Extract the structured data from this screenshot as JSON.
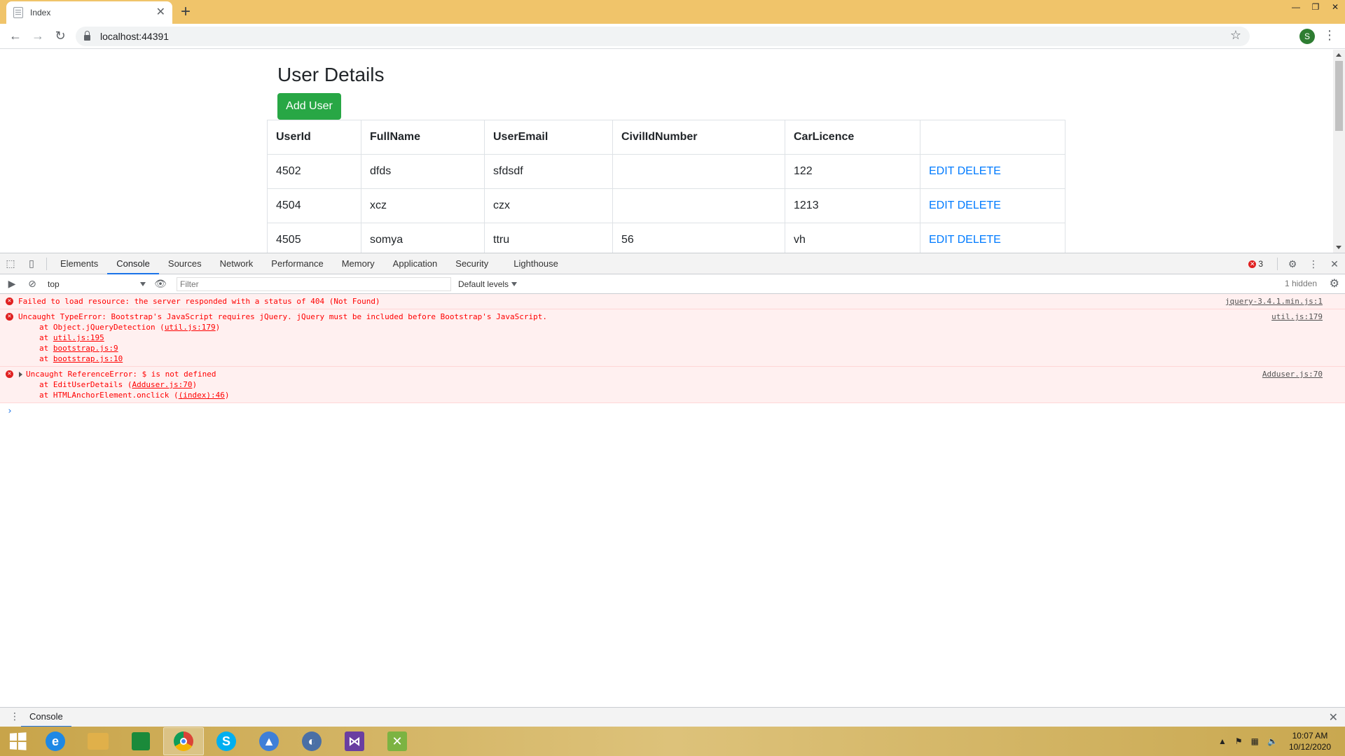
{
  "browser": {
    "tab_title": "Index",
    "url": "localhost:44391",
    "profile_initial": "S"
  },
  "page": {
    "title": "User Details",
    "add_user_label": "Add User",
    "table": {
      "headers": [
        "UserId",
        "FullName",
        "UserEmail",
        "CivilIdNumber",
        "CarLicence",
        ""
      ],
      "rows": [
        {
          "id": "4502",
          "name": "dfds",
          "email": "sfdsdf",
          "civil": "",
          "car": "122",
          "edit": "EDIT",
          "delete": "DELETE"
        },
        {
          "id": "4504",
          "name": "xcz",
          "email": "czx",
          "civil": "",
          "car": "1213",
          "edit": "EDIT",
          "delete": "DELETE"
        },
        {
          "id": "4505",
          "name": "somya",
          "email": "ttru",
          "civil": "56",
          "car": "vh",
          "edit": "EDIT",
          "delete": "DELETE"
        }
      ]
    }
  },
  "devtools": {
    "tabs": [
      "Elements",
      "Console",
      "Sources",
      "Network",
      "Performance",
      "Memory",
      "Application",
      "Security",
      "Lighthouse"
    ],
    "active_tab": "Console",
    "error_count": "3",
    "context": "top",
    "filter_placeholder": "Filter",
    "levels": "Default levels",
    "hidden": "1 hidden",
    "messages": [
      {
        "text": "Failed to load resource: the server responded with a status of 404 (Not Found)",
        "source": "jquery-3.4.1.min.js:1"
      },
      {
        "text": "Uncaught TypeError: Bootstrap's JavaScript requires jQuery. jQuery must be included before Bootstrap's JavaScript.",
        "source": "util.js:179",
        "stack": [
          {
            "prefix": "at Object.jQueryDetection (",
            "link": "util.js:179",
            "suffix": ")"
          },
          {
            "prefix": "at ",
            "link": "util.js:195",
            "suffix": ""
          },
          {
            "prefix": "at ",
            "link": "bootstrap.js:9",
            "suffix": ""
          },
          {
            "prefix": "at ",
            "link": "bootstrap.js:10",
            "suffix": ""
          }
        ]
      },
      {
        "text": "Uncaught ReferenceError: $ is not defined",
        "source": "Adduser.js:70",
        "stack": [
          {
            "prefix": "at EditUserDetails (",
            "link": "Adduser.js:70",
            "suffix": ")"
          },
          {
            "prefix": "at HTMLAnchorElement.onclick (",
            "link": "(index):46",
            "suffix": ")"
          }
        ]
      }
    ],
    "drawer_tab": "Console"
  },
  "taskbar": {
    "time": "10:07 AM",
    "date": "10/12/2020"
  }
}
